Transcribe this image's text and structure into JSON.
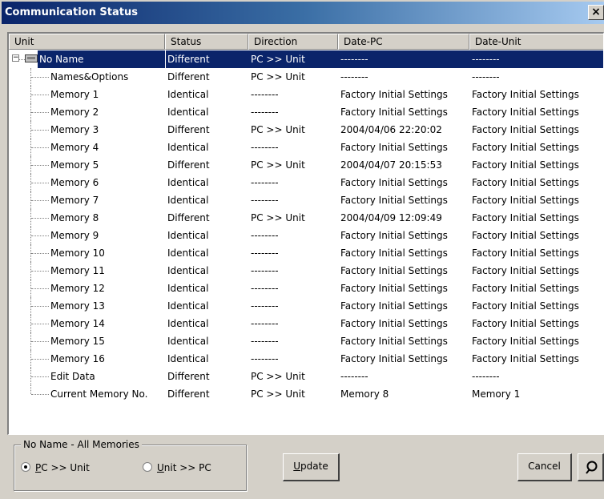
{
  "window": {
    "title": "Communication Status",
    "close_glyph": "×"
  },
  "columns": [
    "Unit",
    "Status",
    "Direction",
    "Date-PC",
    "Date-Unit"
  ],
  "rows": [
    {
      "unit": "No Name",
      "status": "Different",
      "direction": "PC >> Unit",
      "date_pc": "--------",
      "date_unit": "--------",
      "selected": true,
      "root": true
    },
    {
      "unit": "Names&Options",
      "status": "Different",
      "direction": "PC >> Unit",
      "date_pc": "--------",
      "date_unit": "--------"
    },
    {
      "unit": "Memory 1",
      "status": "Identical",
      "direction": "--------",
      "date_pc": "Factory Initial Settings",
      "date_unit": "Factory Initial Settings"
    },
    {
      "unit": "Memory 2",
      "status": "Identical",
      "direction": "--------",
      "date_pc": "Factory Initial Settings",
      "date_unit": "Factory Initial Settings"
    },
    {
      "unit": "Memory 3",
      "status": "Different",
      "direction": "PC >> Unit",
      "date_pc": "2004/04/06 22:20:02",
      "date_unit": "Factory Initial Settings"
    },
    {
      "unit": "Memory 4",
      "status": "Identical",
      "direction": "--------",
      "date_pc": "Factory Initial Settings",
      "date_unit": "Factory Initial Settings"
    },
    {
      "unit": "Memory 5",
      "status": "Different",
      "direction": "PC >> Unit",
      "date_pc": "2004/04/07 20:15:53",
      "date_unit": "Factory Initial Settings"
    },
    {
      "unit": "Memory 6",
      "status": "Identical",
      "direction": "--------",
      "date_pc": "Factory Initial Settings",
      "date_unit": "Factory Initial Settings"
    },
    {
      "unit": "Memory 7",
      "status": "Identical",
      "direction": "--------",
      "date_pc": "Factory Initial Settings",
      "date_unit": "Factory Initial Settings"
    },
    {
      "unit": "Memory 8",
      "status": "Different",
      "direction": "PC >> Unit",
      "date_pc": "2004/04/09 12:09:49",
      "date_unit": "Factory Initial Settings"
    },
    {
      "unit": "Memory 9",
      "status": "Identical",
      "direction": "--------",
      "date_pc": "Factory Initial Settings",
      "date_unit": "Factory Initial Settings"
    },
    {
      "unit": "Memory 10",
      "status": "Identical",
      "direction": "--------",
      "date_pc": "Factory Initial Settings",
      "date_unit": "Factory Initial Settings"
    },
    {
      "unit": "Memory 11",
      "status": "Identical",
      "direction": "--------",
      "date_pc": "Factory Initial Settings",
      "date_unit": "Factory Initial Settings"
    },
    {
      "unit": "Memory 12",
      "status": "Identical",
      "direction": "--------",
      "date_pc": "Factory Initial Settings",
      "date_unit": "Factory Initial Settings"
    },
    {
      "unit": "Memory 13",
      "status": "Identical",
      "direction": "--------",
      "date_pc": "Factory Initial Settings",
      "date_unit": "Factory Initial Settings"
    },
    {
      "unit": "Memory 14",
      "status": "Identical",
      "direction": "--------",
      "date_pc": "Factory Initial Settings",
      "date_unit": "Factory Initial Settings"
    },
    {
      "unit": "Memory 15",
      "status": "Identical",
      "direction": "--------",
      "date_pc": "Factory Initial Settings",
      "date_unit": "Factory Initial Settings"
    },
    {
      "unit": "Memory 16",
      "status": "Identical",
      "direction": "--------",
      "date_pc": "Factory Initial Settings",
      "date_unit": "Factory Initial Settings"
    },
    {
      "unit": "Edit Data",
      "status": "Different",
      "direction": "PC >> Unit",
      "date_pc": "--------",
      "date_unit": "--------"
    },
    {
      "unit": "Current Memory No.",
      "status": "Different",
      "direction": "PC >> Unit",
      "date_pc": "Memory 8",
      "date_unit": "Memory 1"
    }
  ],
  "transfer_group": {
    "label": "No Name - All Memories",
    "options": [
      {
        "label_key": "P",
        "label_rest": "C >> Unit",
        "selected": true
      },
      {
        "label_key": "U",
        "label_rest": "nit >> PC",
        "selected": false
      }
    ]
  },
  "buttons": {
    "update_key": "U",
    "update_rest": "pdate",
    "cancel": "Cancel"
  },
  "icons": {
    "expander": "minus-box-icon",
    "unit": "unit-device-icon",
    "help": "help-pointer-icon"
  },
  "colors": {
    "selection_bg": "#0a246a",
    "dialog_bg": "#d4d0c8",
    "title_gradient_start": "#0a246a",
    "title_gradient_end": "#a6caf0"
  }
}
